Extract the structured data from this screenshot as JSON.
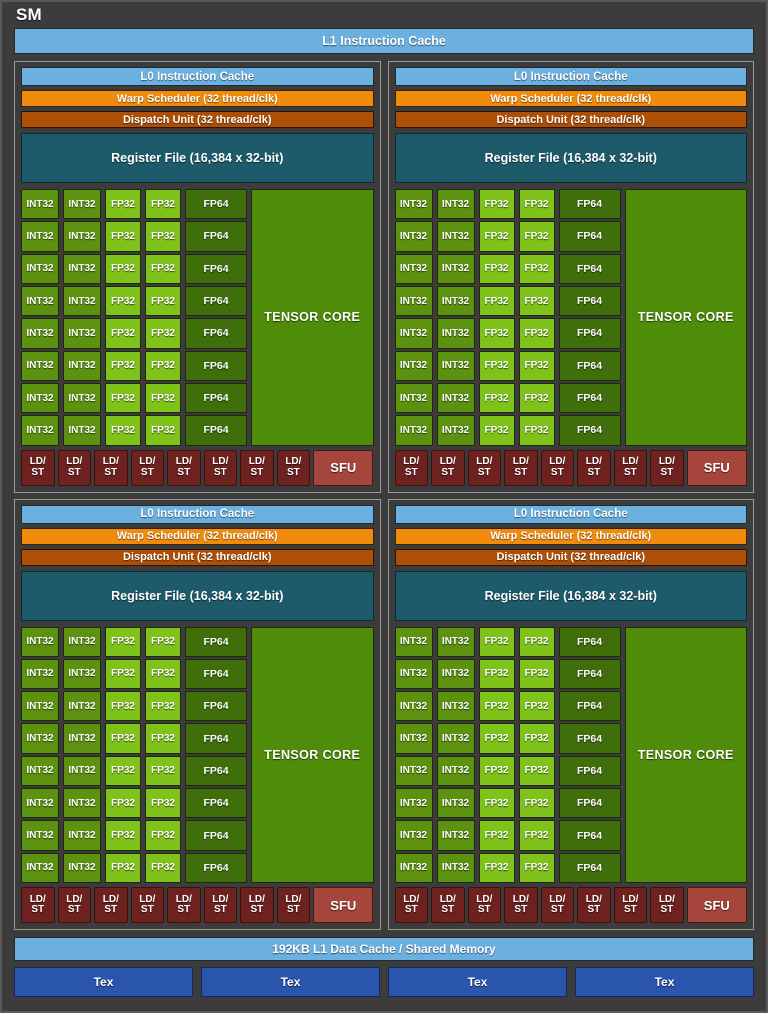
{
  "sm": {
    "title": "SM",
    "l1_instruction_cache": "L1 Instruction Cache",
    "l1_data_cache": "192KB L1 Data Cache / Shared Memory"
  },
  "processing_block": {
    "l0_instruction_cache": "L0 Instruction Cache",
    "warp_scheduler": "Warp Scheduler (32 thread/clk)",
    "dispatch_unit": "Dispatch Unit (32 thread/clk)",
    "register_file": "Register File (16,384 x 32-bit)",
    "tensor_core": "TENSOR CORE",
    "core_rows": 8,
    "int32_label": "INT32",
    "int32_columns": 2,
    "fp32_label": "FP32",
    "fp32_columns": 2,
    "fp64_label": "FP64",
    "fp64_columns": 1,
    "ldst_label_top": "LD/",
    "ldst_label_bottom": "ST",
    "ldst_count": 8,
    "sfu_label": "SFU"
  },
  "tex_units": [
    "Tex",
    "Tex",
    "Tex",
    "Tex"
  ],
  "colors": {
    "background": "#3c3c3c",
    "cache_blue": "#6cb0e0",
    "warp_orange": "#f08b0d",
    "dispatch_brown": "#ad4f06",
    "register_teal": "#1d5b6b",
    "int32_green": "#5d9110",
    "fp32_green": "#7ec21a",
    "fp64_green": "#3f6e0b",
    "tensor_green": "#4f8c0a",
    "ldst_red": "#6e2220",
    "sfu_red": "#a5453c",
    "tex_blue": "#2a55ad"
  }
}
